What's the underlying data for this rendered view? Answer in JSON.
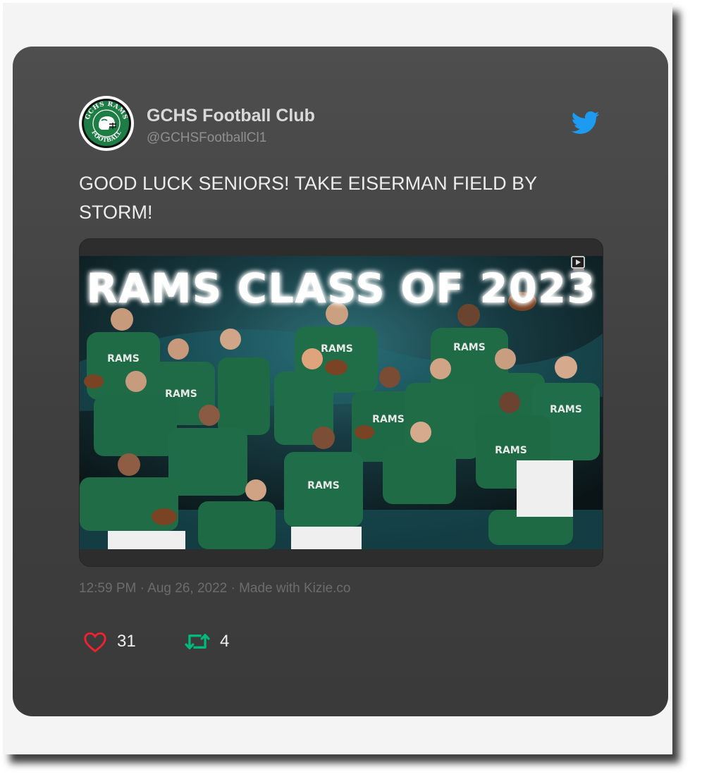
{
  "tweet": {
    "display_name": "GCHS Football Club",
    "handle": "@GCHSFootballCl1",
    "text": "GOOD LUCK SENIORS! TAKE EISERMAN FIELD BY STORM!",
    "media": {
      "overlay_text": "RAMS CLASS OF 2023",
      "jersey_text": "RAMS"
    },
    "meta": "12:59 PM · Aug 26, 2022 · Made with Kizie.co",
    "likes": "31",
    "retweets": "4"
  },
  "avatar": {
    "ring_text_top": "GCHS RAMS",
    "ring_text_bottom": "FOOTBALL"
  },
  "icons": {
    "brand": "twitter-bird-icon",
    "like": "heart-icon",
    "retweet": "retweet-icon",
    "media_badge": "play-icon"
  },
  "colors": {
    "twitter_blue": "#1d9bf0",
    "like_red": "#f4212e",
    "retweet_green": "#00ba7c",
    "jersey_green": "#1e6b46"
  }
}
